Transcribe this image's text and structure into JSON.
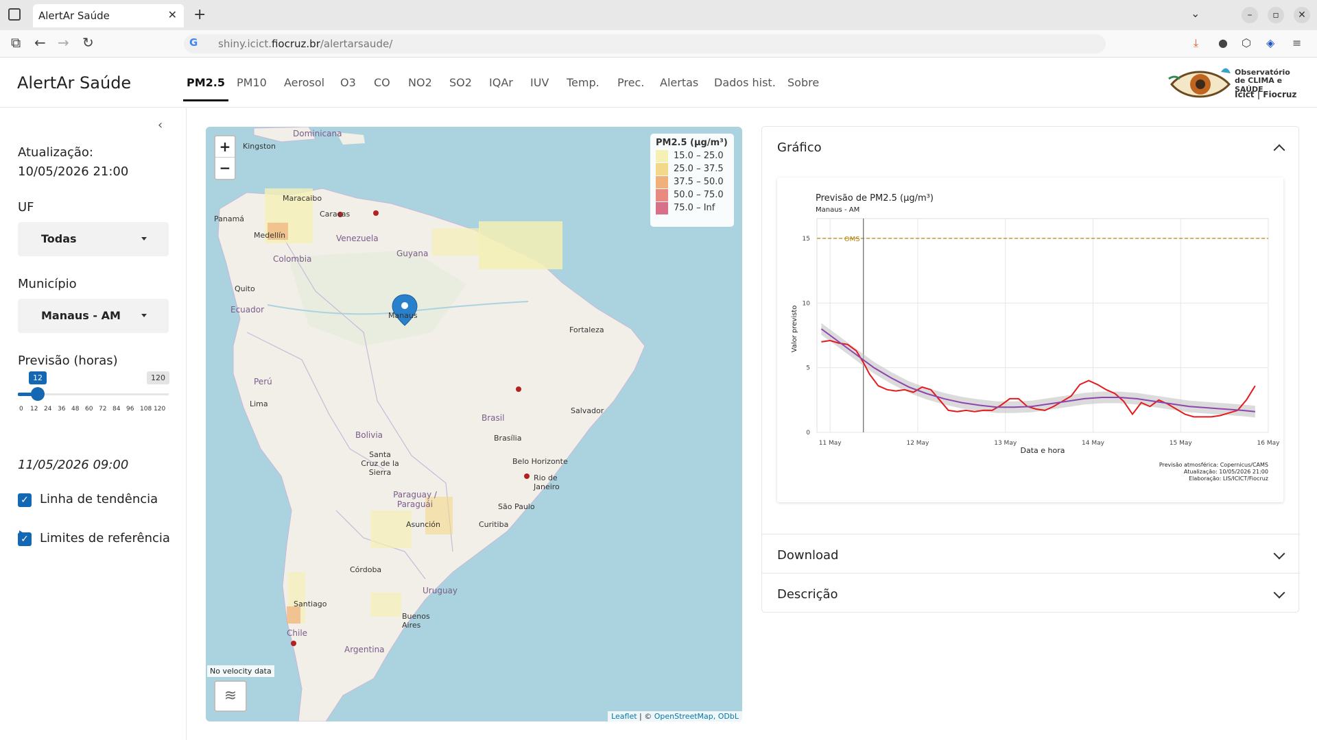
{
  "browser": {
    "tab_title": "AlertAr Saúde",
    "url_host_prefix": "shiny.icict.",
    "url_host_bold": "fiocruz.br",
    "url_path": "/alertarsaude/"
  },
  "app": {
    "title": "AlertAr Saúde",
    "nav": [
      "PM2.5",
      "PM10",
      "Aerosol",
      "O3",
      "CO",
      "NO2",
      "SO2",
      "IQAr",
      "IUV",
      "Temp.",
      "Prec.",
      "Alertas",
      "Dados hist.",
      "Sobre"
    ],
    "active_nav": "PM2.5",
    "logo": {
      "line1": "Observatório",
      "line2": "de CLIMA e SAÚDE",
      "line3": "Icict | Fiocruz"
    }
  },
  "sidebar": {
    "update_label": "Atualização:",
    "update_value": "10/05/2026 21:00",
    "uf_label": "UF",
    "uf_value": "Todas",
    "municipio_label": "Município",
    "municipio_value": "Manaus - AM",
    "forecast_label": "Previsão (horas)",
    "slider_value": "12",
    "slider_max": "120",
    "slider_ticks": [
      "0",
      "12",
      "24",
      "36",
      "48",
      "60",
      "72",
      "84",
      "96",
      "108",
      "120"
    ],
    "forecast_datetime": "11/05/2026 09:00",
    "checks": [
      {
        "label": "Linha de tendência",
        "checked": true
      },
      {
        "label": "Limites de referência",
        "checked": true
      }
    ]
  },
  "map": {
    "zoom_in": "+",
    "zoom_out": "−",
    "legend_title": "PM2.5 (µg/m³)",
    "legend": [
      {
        "label": "15.0 – 25.0",
        "color": "#f5f0b4"
      },
      {
        "label": "25.0 – 37.5",
        "color": "#f3d88a"
      },
      {
        "label": "37.5 – 50.0",
        "color": "#f0b07a"
      },
      {
        "label": "50.0 – 75.0",
        "color": "#e88a80"
      },
      {
        "label": "75.0 – Inf",
        "color": "#d8708a"
      }
    ],
    "no_velocity": "No velocity data",
    "attrib_leaflet": "Leaflet",
    "attrib_rest": " | © ",
    "attrib_osm": "OpenStreetMap, ODbL",
    "marker_label": "Manaus",
    "cities": [
      "Kingston",
      "Maracaibo",
      "Caracas",
      "Panamá",
      "Medellín",
      "Quito",
      "Fortaleza",
      "Lima",
      "Salvador",
      "Brasília",
      "Belo Horizonte",
      "Rio de Janeiro",
      "São Paulo",
      "Curitiba",
      "Asunción",
      "Córdoba",
      "Santiago",
      "Buenos Aires"
    ],
    "countries": [
      "Dominicana",
      "Venezuela",
      "Guyana",
      "Colombia",
      "Ecuador",
      "Perú",
      "Bolivia",
      "Brasil",
      "Paraguay / Paraguái",
      "Uruguay",
      "Chile",
      "Argentina"
    ],
    "santa_cruz": "Santa Cruz de la Sierra"
  },
  "panel": {
    "grafico_title": "Gráfico",
    "download_title": "Download",
    "descricao_title": "Descrição"
  },
  "chart_data": {
    "type": "line",
    "title": "Previsão de PM2.5 (µg/m³)",
    "subtitle": "Manaus - AM",
    "xlabel": "Data e hora",
    "ylabel": "Valor previsto",
    "x_ticks": [
      "11 May",
      "12 May",
      "13 May",
      "14 May",
      "15 May",
      "16 May"
    ],
    "y_ticks": [
      0,
      5,
      10,
      15
    ],
    "ylim": [
      0,
      16
    ],
    "xlim": [
      10.85,
      16.0
    ],
    "reference": {
      "name": "OMS",
      "value": 15,
      "color": "#b8860b"
    },
    "current_time": 11.38,
    "series": [
      {
        "color": "#e41a1c",
        "x": [
          10.9,
          11.0,
          11.1,
          11.2,
          11.3,
          11.38,
          11.45,
          11.55,
          11.65,
          11.75,
          11.85,
          11.95,
          12.05,
          12.15,
          12.25,
          12.35,
          12.45,
          12.55,
          12.65,
          12.75,
          12.85,
          12.95,
          13.05,
          13.15,
          13.25,
          13.35,
          13.45,
          13.55,
          13.65,
          13.75,
          13.85,
          13.95,
          14.05,
          14.15,
          14.25,
          14.35,
          14.45,
          14.55,
          14.65,
          14.75,
          14.85,
          14.95,
          15.05,
          15.15,
          15.25,
          15.35,
          15.45,
          15.55,
          15.65,
          15.75,
          15.85
        ],
        "values": [
          7.0,
          7.1,
          6.9,
          6.8,
          6.3,
          5.4,
          4.5,
          3.6,
          3.3,
          3.2,
          3.3,
          3.1,
          3.5,
          3.3,
          2.5,
          1.7,
          1.6,
          1.7,
          1.6,
          1.7,
          1.7,
          2.1,
          2.6,
          2.6,
          2.0,
          1.8,
          1.7,
          2.0,
          2.4,
          2.8,
          3.7,
          4.0,
          3.7,
          3.3,
          3.0,
          2.4,
          1.4,
          2.3,
          2.0,
          2.5,
          2.2,
          1.8,
          1.4,
          1.2,
          1.2,
          1.2,
          1.3,
          1.5,
          1.7,
          2.5,
          3.6
        ]
      },
      {
        "color": "#8e44ad",
        "x": [
          10.9,
          11.1,
          11.3,
          11.5,
          11.7,
          11.9,
          12.1,
          12.3,
          12.5,
          12.7,
          12.9,
          13.1,
          13.3,
          13.5,
          13.7,
          13.9,
          14.1,
          14.3,
          14.5,
          14.7,
          14.9,
          15.1,
          15.3,
          15.5,
          15.7,
          15.85
        ],
        "values": [
          8.0,
          7.0,
          6.0,
          5.0,
          4.2,
          3.5,
          3.0,
          2.6,
          2.3,
          2.1,
          1.95,
          1.95,
          2.0,
          2.2,
          2.4,
          2.6,
          2.7,
          2.7,
          2.6,
          2.4,
          2.2,
          2.0,
          1.9,
          1.8,
          1.7,
          1.6
        ]
      }
    ],
    "caption": [
      "Previsão atmosférica: Copernicus/CAMS",
      "Atualização: 10/05/2026 21:00",
      "Elaboração: LIS/ICICT/Fiocruz"
    ]
  }
}
